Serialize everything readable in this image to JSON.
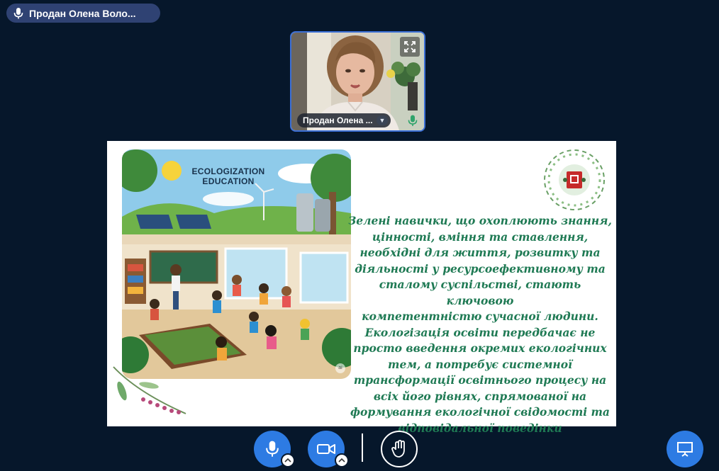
{
  "presenter": {
    "name": "Продан Олена Воло..."
  },
  "webcam": {
    "name_tag": "Продан Олена ..."
  },
  "slide": {
    "illustration_title_line1": "ECOLOGIZATION",
    "illustration_title_line2": "EDUCATION",
    "ai_mark": "ai",
    "body_lines": [
      "Зелені навички, що охоплюють знання,",
      "цінності, вміння та ставлення,",
      "необхідні для життя, розвитку та",
      "діяльності у ресурсоефективному та",
      "сталому суспільстві, стають ключовою",
      "компетентністю сучасної людини.",
      "Екологізація освіти передбачає не",
      "просто введення окремих екологічних",
      "тем, а потребує системної",
      "трансформації освітнього процесу на",
      "всіх його рівнях, спрямованої на",
      "формування екологічної свідомості та",
      "відповідальної поведінки"
    ]
  },
  "colors": {
    "background": "#06172b",
    "accent_blue": "#2d7be3",
    "pill": "#2f4273",
    "slide_text_green": "#1f7a54"
  },
  "icons": {
    "pill_mic": "microphone-icon",
    "fullscreen": "fullscreen-icon",
    "webcam_mic": "microphone-icon",
    "mic_button": "microphone-icon",
    "camera_button": "video-camera-icon",
    "hand_button": "raise-hand-icon",
    "present_button": "presentation-screen-icon"
  }
}
